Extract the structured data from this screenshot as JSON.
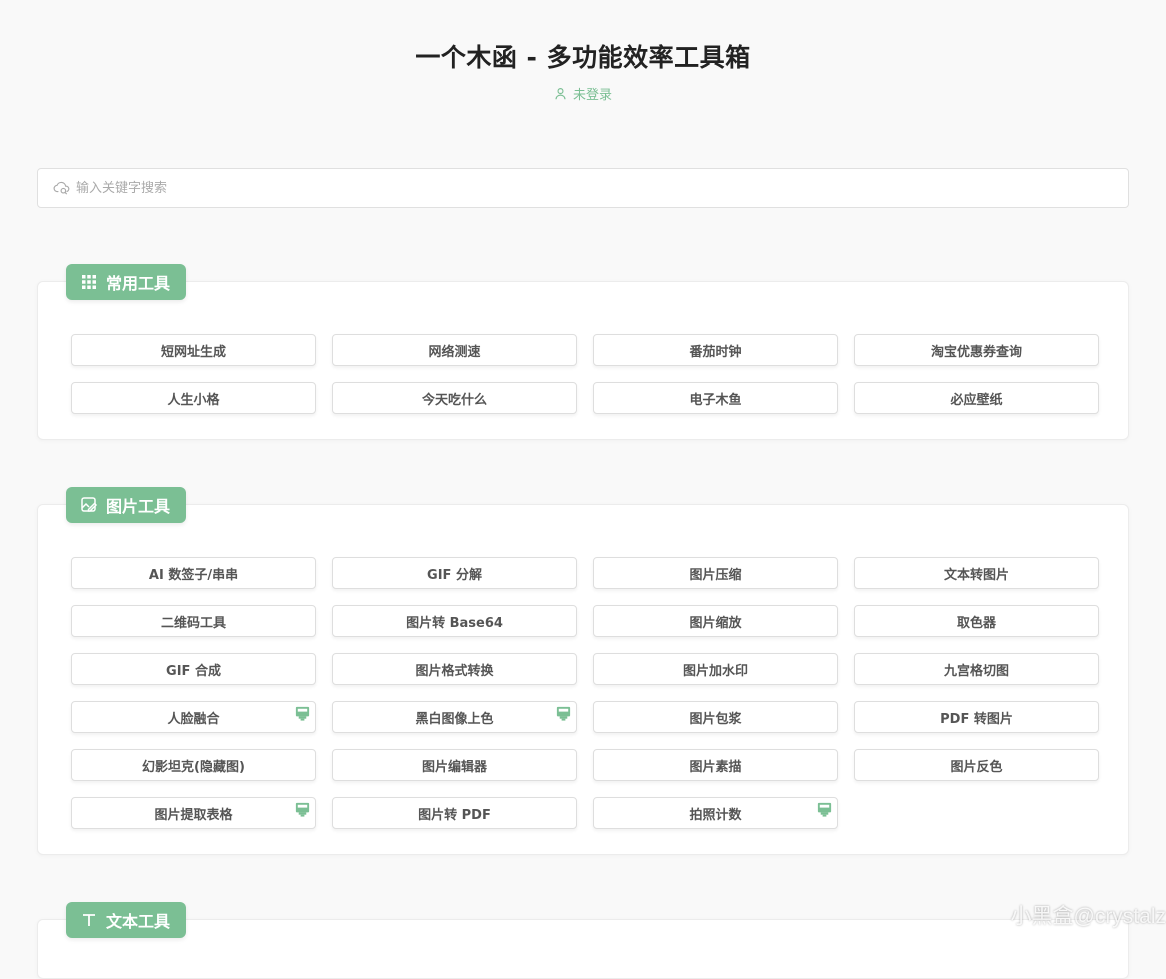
{
  "header": {
    "title": "一个木函 - 多功能效率工具箱",
    "login_status": "未登录"
  },
  "search": {
    "placeholder": "输入关键字搜索"
  },
  "sections": [
    {
      "label": "常用工具",
      "icon": "grid-icon",
      "tools": [
        {
          "label": "短网址生成",
          "badge": false
        },
        {
          "label": "网络测速",
          "badge": false
        },
        {
          "label": "番茄时钟",
          "badge": false
        },
        {
          "label": "淘宝优惠券查询",
          "badge": false
        },
        {
          "label": "人生小格",
          "badge": false
        },
        {
          "label": "今天吃什么",
          "badge": false
        },
        {
          "label": "电子木鱼",
          "badge": false
        },
        {
          "label": "必应壁纸",
          "badge": false
        }
      ]
    },
    {
      "label": "图片工具",
      "icon": "image-edit-icon",
      "tools": [
        {
          "label": "AI 数签子/串串",
          "badge": false
        },
        {
          "label": "GIF 分解",
          "badge": false
        },
        {
          "label": "图片压缩",
          "badge": false
        },
        {
          "label": "文本转图片",
          "badge": false
        },
        {
          "label": "二维码工具",
          "badge": false
        },
        {
          "label": "图片转 Base64",
          "badge": false
        },
        {
          "label": "图片缩放",
          "badge": false
        },
        {
          "label": "取色器",
          "badge": false
        },
        {
          "label": "GIF 合成",
          "badge": false
        },
        {
          "label": "图片格式转换",
          "badge": false
        },
        {
          "label": "图片加水印",
          "badge": false
        },
        {
          "label": "九宫格切图",
          "badge": false
        },
        {
          "label": "人脸融合",
          "badge": true
        },
        {
          "label": "黑白图像上色",
          "badge": true
        },
        {
          "label": "图片包浆",
          "badge": false
        },
        {
          "label": "PDF 转图片",
          "badge": false
        },
        {
          "label": "幻影坦克(隐藏图)",
          "badge": false
        },
        {
          "label": "图片编辑器",
          "badge": false
        },
        {
          "label": "图片素描",
          "badge": false
        },
        {
          "label": "图片反色",
          "badge": false
        },
        {
          "label": "图片提取表格",
          "badge": true
        },
        {
          "label": "图片转 PDF",
          "badge": false
        },
        {
          "label": "拍照计数",
          "badge": true
        }
      ]
    },
    {
      "label": "文本工具",
      "icon": "text-icon",
      "tools": []
    }
  ],
  "watermark": "小黑盒@crystalz",
  "colors": {
    "accent": "#7bbf94",
    "background": "#f9f9f9"
  }
}
